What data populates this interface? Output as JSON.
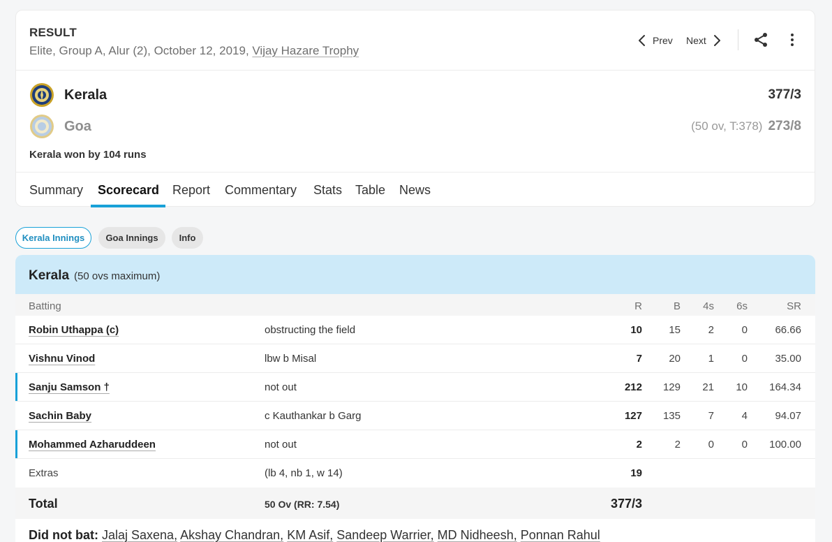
{
  "header": {
    "status": "RESULT",
    "info_prefix": "Elite, Group A, Alur (2), October 12, 2019, ",
    "series": "Vijay Hazare Trophy",
    "prev_label": "Prev",
    "next_label": "Next"
  },
  "teams": [
    {
      "name": "Kerala",
      "sub": "",
      "score": "377/3"
    },
    {
      "name": "Goa",
      "sub": "(50 ov, T:378)",
      "score": "273/8"
    }
  ],
  "result_text": "Kerala won by 104 runs",
  "tabs": [
    "Summary",
    "Scorecard",
    "Report",
    "Commentary",
    "Stats",
    "Table",
    "News"
  ],
  "active_tab": "Scorecard",
  "innings_pills": [
    "Kerala Innings",
    "Goa Innings",
    "Info"
  ],
  "innings": {
    "team": "Kerala",
    "max": "(50 ovs maximum)",
    "headers": {
      "batting": "Batting",
      "r": "R",
      "b": "B",
      "fours": "4s",
      "sixes": "6s",
      "sr": "SR"
    },
    "batters": [
      {
        "name": "Robin Uthappa (c)",
        "dismissal": "obstructing the field",
        "r": "10",
        "b": "15",
        "fours": "2",
        "sixes": "0",
        "sr": "66.66",
        "live": false
      },
      {
        "name": "Vishnu Vinod",
        "dismissal": "lbw b Misal",
        "r": "7",
        "b": "20",
        "fours": "1",
        "sixes": "0",
        "sr": "35.00",
        "live": false
      },
      {
        "name": "Sanju Samson †",
        "dismissal": "not out",
        "r": "212",
        "b": "129",
        "fours": "21",
        "sixes": "10",
        "sr": "164.34",
        "live": true
      },
      {
        "name": "Sachin Baby",
        "dismissal": "c Kauthankar b Garg",
        "r": "127",
        "b": "135",
        "fours": "7",
        "sixes": "4",
        "sr": "94.07",
        "live": false
      },
      {
        "name": "Mohammed Azharuddeen",
        "dismissal": "not out",
        "r": "2",
        "b": "2",
        "fours": "0",
        "sixes": "0",
        "sr": "100.00",
        "live": true
      }
    ],
    "extras": {
      "label": "Extras",
      "detail": "(lb 4, nb 1, w 14)",
      "value": "19"
    },
    "total": {
      "label": "Total",
      "overs": "50 Ov (RR: 7.54)",
      "score": "377/3"
    },
    "did_not_bat": {
      "label": "Did not bat:",
      "players": [
        "Jalaj Saxena,",
        "Akshay Chandran,",
        "KM Asif,",
        "Sandeep Warrier,",
        "MD Nidheesh,",
        "Ponnan Rahul"
      ]
    }
  },
  "icons": {
    "prev": "chevron-left-icon",
    "next": "chevron-right-icon",
    "share": "share-icon",
    "more": "more-vertical-icon"
  },
  "colors": {
    "accent": "#18a1d8",
    "innings_header": "#cdeaf9"
  }
}
